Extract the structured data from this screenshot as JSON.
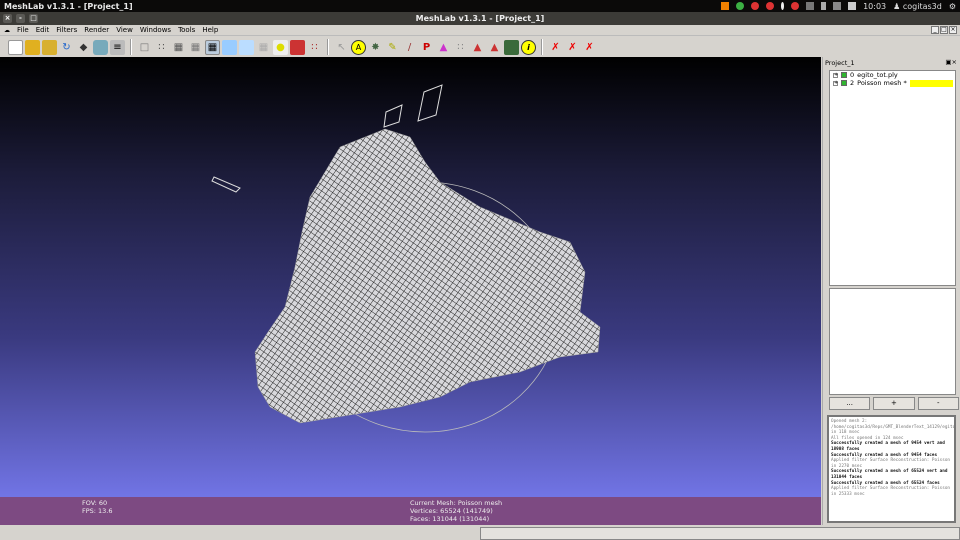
{
  "system": {
    "app_title": "MeshLab v1.3.1 - [Project_1]",
    "clock": "10:03",
    "user": "cogitas3d"
  },
  "window": {
    "title": "MeshLab v1.3.1 - [Project_1]"
  },
  "menu": [
    "File",
    "Edit",
    "Filters",
    "Render",
    "View",
    "Windows",
    "Tools",
    "Help"
  ],
  "panel": {
    "title": "Project_1",
    "layers": [
      {
        "id": "0",
        "name": "egito_tot.ply",
        "selected": false
      },
      {
        "id": "2",
        "name": "Poisson mesh *",
        "selected": true
      }
    ],
    "buttons": [
      "...",
      "+",
      "-"
    ],
    "log": [
      {
        "text": "Opened mesh 2:",
        "bold": false
      },
      {
        "text": "/home/cogitas3d/Reps/GMT_BlenderText_14129/egito_tot.ply in 118 msec",
        "bold": false
      },
      {
        "text": "All files opened in 124 msec",
        "bold": false
      },
      {
        "text": "Successfully created a mesh of 9454 vert and 18908 faces",
        "bold": true
      },
      {
        "text": "Successfully created a mesh of 9454 faces",
        "bold": true
      },
      {
        "text": "Applied filter Surface Reconstruction: Poisson in 2270 msec",
        "bold": false
      },
      {
        "text": "Successfully created a mesh of 65524 vert and 131044 faces",
        "bold": true
      },
      {
        "text": "Successfully created a mesh of 65524 faces",
        "bold": true
      },
      {
        "text": "Applied filter Surface Reconstruction: Poisson in 25333 msec",
        "bold": false
      }
    ]
  },
  "viewport": {
    "fov": "FOV: 60",
    "fps": "FPS:   13.6",
    "current_mesh": "Current Mesh: Poisson mesh",
    "vertices": "Vertices: 65524 (141749)",
    "faces": "Faces: 131044 (131044)"
  },
  "colors": {
    "status_bg": "#7d4a82",
    "selection": "#ffff00"
  }
}
